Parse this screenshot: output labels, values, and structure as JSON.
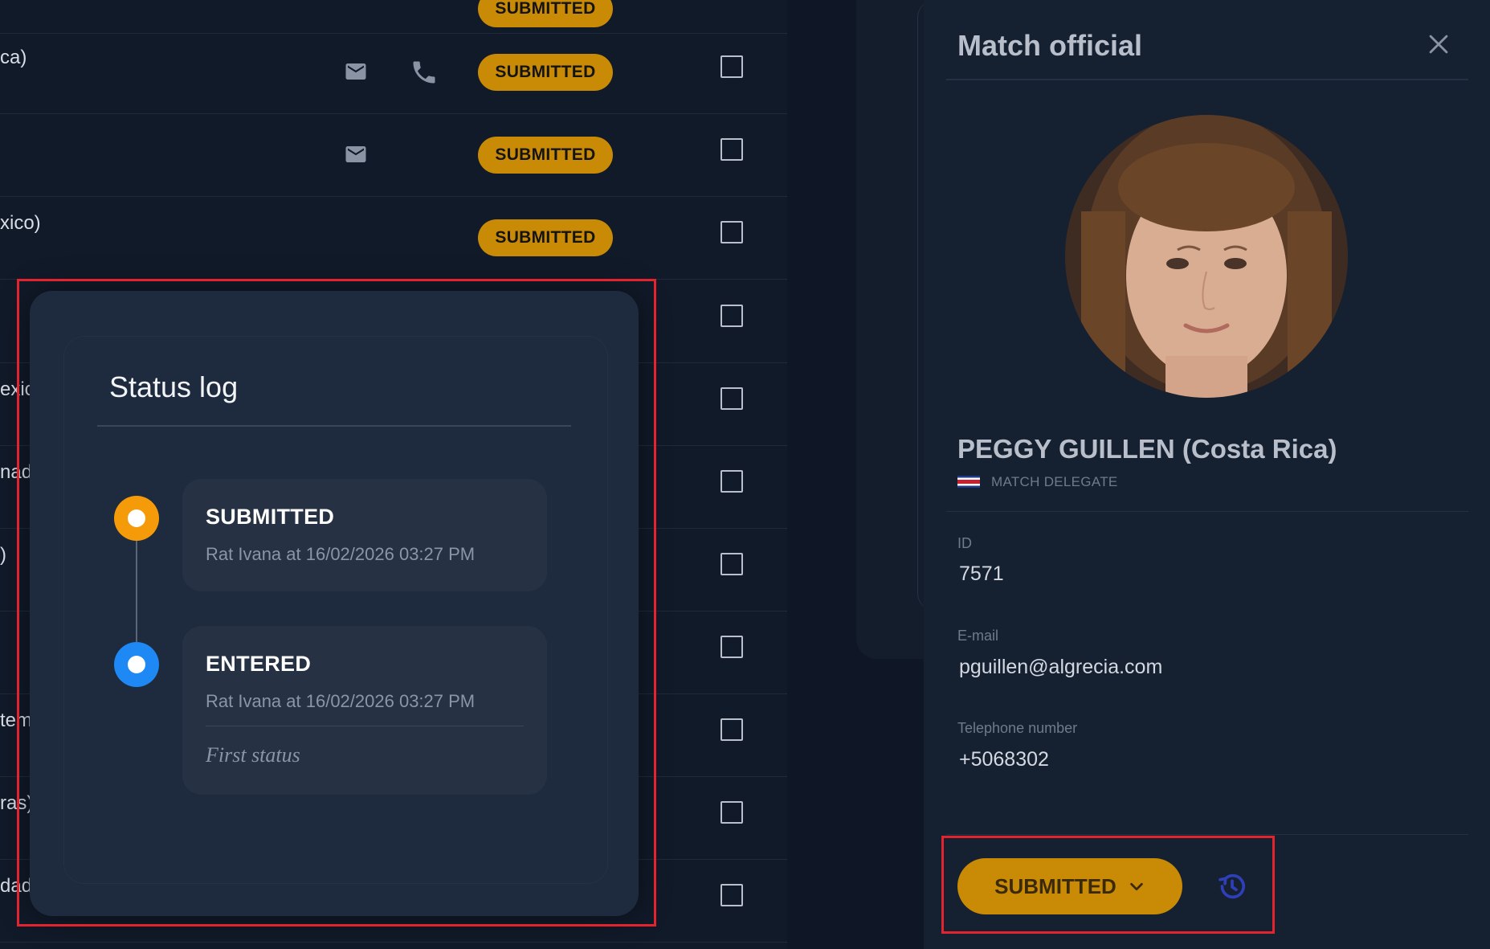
{
  "table": {
    "rows": [
      {
        "name": "",
        "mail": false,
        "phone": false,
        "status": "SUBMITTED"
      },
      {
        "name": "ca)",
        "mail": true,
        "phone": true,
        "status": "SUBMITTED"
      },
      {
        "name": "",
        "mail": true,
        "phone": false,
        "status": "SUBMITTED"
      },
      {
        "name": "xico)",
        "mail": false,
        "phone": false,
        "status": "SUBMITTED"
      },
      {
        "name": "",
        "mail": false,
        "phone": false,
        "status": ""
      },
      {
        "name": "exic",
        "mail": false,
        "phone": false,
        "status": ""
      },
      {
        "name": "nad",
        "mail": false,
        "phone": false,
        "status": ""
      },
      {
        "name": ")",
        "mail": false,
        "phone": false,
        "status": ""
      },
      {
        "name": "",
        "mail": false,
        "phone": false,
        "status": ""
      },
      {
        "name": "tem",
        "mail": false,
        "phone": false,
        "status": ""
      },
      {
        "name": "ras)",
        "mail": false,
        "phone": false,
        "status": ""
      },
      {
        "name": "dad",
        "mail": false,
        "phone": false,
        "status": ""
      }
    ]
  },
  "drawer": {
    "title": "Match official",
    "name": "PEGGY GUILLEN (Costa Rica)",
    "role": "MATCH DELEGATE",
    "fields": [
      {
        "label": "ID",
        "value": "7571"
      },
      {
        "label": "E-mail",
        "value": "pguillen@algrecia.com"
      },
      {
        "label": "Telephone number",
        "value": "+5068302"
      }
    ],
    "status_button": "SUBMITTED"
  },
  "status_log": {
    "title": "Status log",
    "entries": [
      {
        "status": "SUBMITTED",
        "meta": "Rat Ivana at 16/02/2026 03:27 PM",
        "note": "",
        "color": "#f59b0a"
      },
      {
        "status": "ENTERED",
        "meta": "Rat Ivana at 16/02/2026 03:27 PM",
        "note": "First status",
        "color": "#1e88f5"
      }
    ]
  },
  "colors": {
    "badge": "#c98a06",
    "highlight": "#e3232e",
    "history_icon": "#2f3fb8"
  }
}
